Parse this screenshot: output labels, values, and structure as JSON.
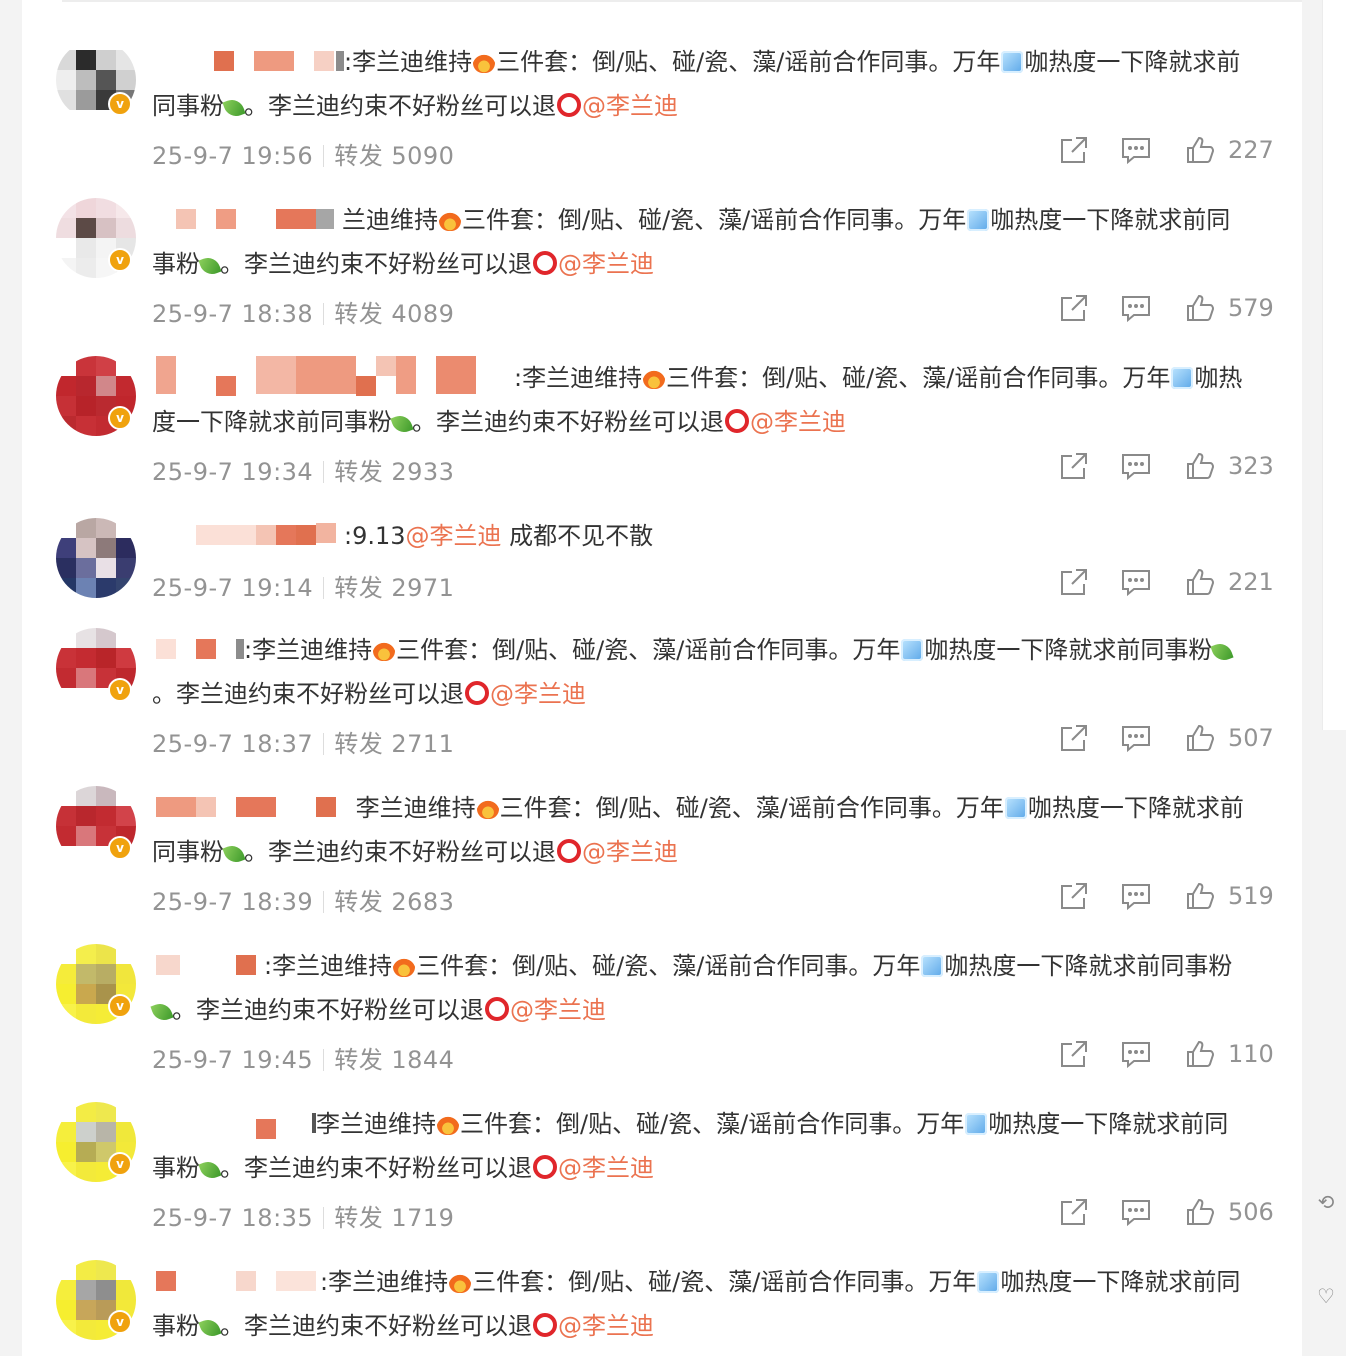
{
  "page": {
    "type": "weibo-comments-feed"
  },
  "labels": {
    "repost": "转发"
  },
  "colors": {
    "mention": "#eb7350",
    "meta": "#939393",
    "text": "#333333",
    "badge": "#f0a20e"
  },
  "icons": {
    "share": "share-icon",
    "comment": "comment-icon",
    "like": "like-icon",
    "verified": "verified-badge-icon"
  },
  "side_tools": [
    {
      "icon": "refresh-help-icon"
    },
    {
      "icon": "feedback-icon"
    }
  ],
  "comments": [
    {
      "name_mask": "blurred",
      "text_a": ":李兰迪维持",
      "text_b": "三件套：倒/贴、碰/瓷、藻/谣前合作同事。万年",
      "text_c": "咖热度一下降就求前同事粉",
      "text_d": "。李兰迪约束不好粉丝可以退",
      "mention": "@李兰迪",
      "time": "25-9-7 19:56",
      "repost_count": "5090",
      "likes": "227"
    },
    {
      "name_mask": "blurred",
      "text_a": "兰迪维持",
      "text_b": "三件套：倒/贴、碰/瓷、藻/谣前合作同事。万年",
      "text_c": "咖热度一下降就求前同事粉",
      "text_d": "。李兰迪约束不好粉丝可以退",
      "mention": "@李兰迪",
      "time": "25-9-7 18:38",
      "repost_count": "4089",
      "likes": "579"
    },
    {
      "name_mask": "blurred",
      "text_a": ":李兰迪维持",
      "text_b": "三件套：倒/贴、碰/瓷、藻/谣前合作同事。万年",
      "text_c": "咖热度一下降就求前同事粉",
      "text_d": "。李兰迪约束不好粉丝可以退",
      "mention": "@李兰迪",
      "time": "25-9-7 19:34",
      "repost_count": "2933",
      "likes": "323"
    },
    {
      "name_mask": "blurred",
      "text_a": ":9.13",
      "mention": "@李兰迪",
      "text_e": " 成都不见不散",
      "time": "25-9-7 19:14",
      "repost_count": "2971",
      "likes": "221"
    },
    {
      "name_mask": "blurred",
      "text_a": ":李兰迪维持",
      "text_b": "三件套：倒/贴、碰/瓷、藻/谣前合作同事。万年",
      "text_c": "咖热度一下降就求前同事粉",
      "text_d": "。李兰迪约束不好粉丝可以退",
      "mention": "@李兰迪",
      "time": "25-9-7 18:37",
      "repost_count": "2711",
      "likes": "507"
    },
    {
      "name_mask": "blurred",
      "text_a": " 李兰迪维持",
      "text_b": "三件套：倒/贴、碰/瓷、藻/谣前合作同事。万年",
      "text_c": "咖热度一下降就求前同事粉",
      "text_d": "。李兰迪约束不好粉丝可以退",
      "mention": "@李兰迪",
      "time": "25-9-7 18:39",
      "repost_count": "2683",
      "likes": "519"
    },
    {
      "name_mask": "blurred",
      "text_a": ":李兰迪维持",
      "text_b": "三件套：倒/贴、碰/瓷、藻/谣前合作同事。万年",
      "text_c": "咖热度一下降就求前同事粉",
      "text_d": "。李兰迪约束不好粉丝可以退",
      "mention": "@李兰迪",
      "time": "25-9-7 19:45",
      "repost_count": "1844",
      "likes": "110"
    },
    {
      "name_mask": "blurred",
      "text_a": "李兰迪维持",
      "text_b": "三件套：倒/贴、碰/瓷、藻/谣前合作同事。万年",
      "text_c": "咖热度一下降就求前同事粉",
      "text_d": "。李兰迪约束不好粉丝可以退",
      "mention": "@李兰迪",
      "time": "25-9-7 18:35",
      "repost_count": "1719",
      "likes": "506"
    },
    {
      "name_mask": "blurred",
      "text_a": ":李兰迪维持",
      "text_b": "三件套：倒/贴、碰/瓷、藻/谣前合作同事。万年",
      "text_c": "咖热度一下降就求前同事粉",
      "text_d": "。李兰迪约束不好粉丝可以退",
      "mention": "@李兰迪"
    }
  ]
}
